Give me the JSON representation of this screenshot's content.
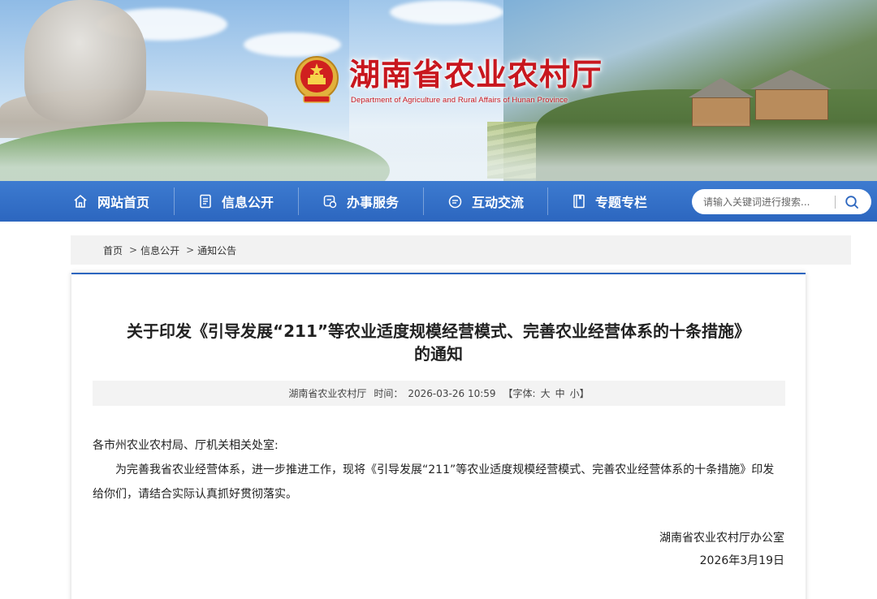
{
  "header": {
    "site_title": "湖南省农业农村厅",
    "site_subtitle": "Department of Agriculture and Rural Affairs of Hunan Province"
  },
  "nav": {
    "items": [
      {
        "label": "网站首页",
        "icon": "home-icon"
      },
      {
        "label": "信息公开",
        "icon": "document-icon"
      },
      {
        "label": "办事服务",
        "icon": "service-icon"
      },
      {
        "label": "互动交流",
        "icon": "chat-icon"
      },
      {
        "label": "专题专栏",
        "icon": "book-icon"
      }
    ],
    "search_placeholder": "请输入关键词进行搜索..."
  },
  "breadcrumb": [
    "首页",
    "信息公开",
    "通知公告"
  ],
  "article": {
    "title_line1": "关于印发《引导发展“211”等农业适度规模经营模式、完善农业经营体系的十条措施》",
    "title_line2": "的通知",
    "meta": {
      "source": "湖南省农业农村厅",
      "time_label": "时间：",
      "time": "2026-03-26 10:59",
      "font_label": "【字体:",
      "font_large": "大",
      "font_medium": "中",
      "font_small": "小】"
    },
    "salutation": "各市州农业农村局、厅机关相关处室:",
    "paragraph": "为完善我省农业经营体系，进一步推进工作，现将《引导发展“211”等农业适度规模经营模式、完善农业经营体系的十条措施》印发给你们，请结合实际认真抓好贯彻落实。",
    "signature": "湖南省农业农村厅办公室",
    "date": "2026年3月19日"
  },
  "colors": {
    "nav_blue": "#2c66bf",
    "title_red": "#c8171e"
  }
}
